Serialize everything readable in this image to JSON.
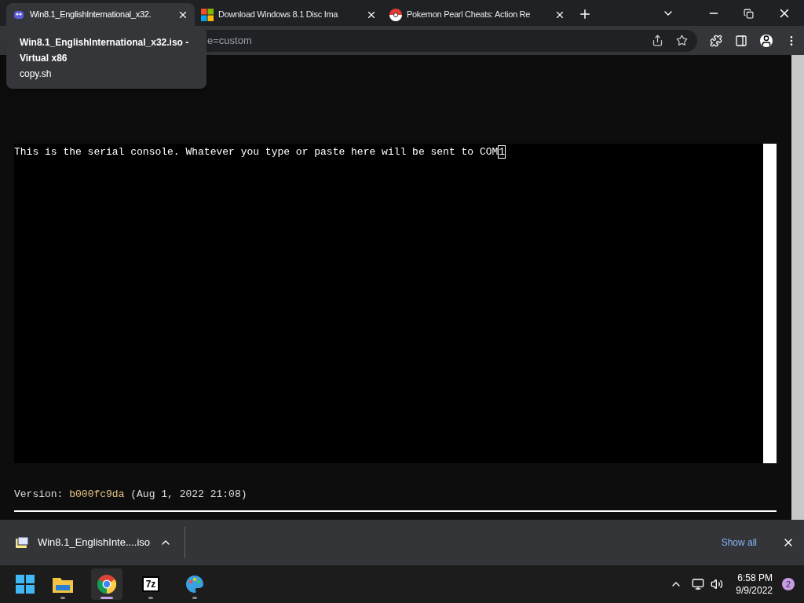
{
  "tabs": [
    {
      "title": "Win8.1_EnglishInternational_x32.",
      "selected": true
    },
    {
      "title": "Download Windows 8.1 Disc Ima",
      "selected": false
    },
    {
      "title": "Pokemon Pearl Cheats: Action Re",
      "selected": false
    }
  ],
  "tooltip": {
    "title": "Win8.1_EnglishInternational_x32.iso - Virtual x86",
    "subtitle": "copy.sh"
  },
  "address": "e=custom",
  "console": {
    "text": "This is the serial console. Whatever you type or paste here will be sent to COM",
    "cursor": "1"
  },
  "version": {
    "label": "Version:",
    "hash": "b000fc9da",
    "date": "(Aug 1, 2022 21:08)"
  },
  "download": {
    "file": "Win8.1_EnglishInte....iso",
    "show_all": "Show all"
  },
  "taskbar": {
    "apps": [
      {
        "kind": "explorer",
        "active": false
      },
      {
        "kind": "chrome",
        "active": true
      },
      {
        "kind": "archiver",
        "label": "7z",
        "active": false
      },
      {
        "kind": "paint",
        "active": false
      }
    ],
    "time": "6:58 PM",
    "date": "9/9/2022",
    "notifications": "2"
  }
}
